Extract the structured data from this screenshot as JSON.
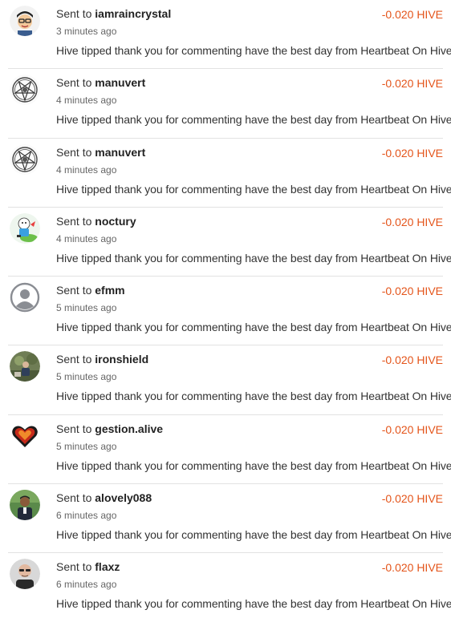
{
  "transfers": [
    {
      "prefix": "Sent to",
      "user": "iamraincrystal",
      "amount": "-0.020 HIVE",
      "time": "3 minutes ago",
      "memo": "Hive tipped thank you for commenting have the best day from Heartbeat On Hive",
      "avatar": "cartoon-face-avatar"
    },
    {
      "prefix": "Sent to",
      "user": "manuvert",
      "amount": "-0.020 HIVE",
      "time": "4 minutes ago",
      "memo": "Hive tipped thank you for commenting have the best day from Heartbeat On Hive",
      "avatar": "pentagram-avatar"
    },
    {
      "prefix": "Sent to",
      "user": "manuvert",
      "amount": "-0.020 HIVE",
      "time": "4 minutes ago",
      "memo": "Hive tipped thank you for commenting have the best day from Heartbeat On Hive",
      "avatar": "pentagram-avatar"
    },
    {
      "prefix": "Sent to",
      "user": "noctury",
      "amount": "-0.020 HIVE",
      "time": "4 minutes ago",
      "memo": "Hive tipped thank you for commenting have the best day from Heartbeat On Hive",
      "avatar": "cartoon-character-avatar"
    },
    {
      "prefix": "Sent to",
      "user": "efmm",
      "amount": "-0.020 HIVE",
      "time": "5 minutes ago",
      "memo": "Hive tipped thank you for commenting have the best day from Heartbeat On Hive",
      "avatar": "default-user-icon"
    },
    {
      "prefix": "Sent to",
      "user": "ironshield",
      "amount": "-0.020 HIVE",
      "time": "5 minutes ago",
      "memo": "Hive tipped thank you for commenting have the best day from Heartbeat On Hive",
      "avatar": "photo-avatar"
    },
    {
      "prefix": "Sent to",
      "user": "gestion.alive",
      "amount": "-0.020 HIVE",
      "time": "5 minutes ago",
      "memo": "Hive tipped thank you for commenting have the best day from Heartbeat On Hive",
      "avatar": "heart-avatar"
    },
    {
      "prefix": "Sent to",
      "user": "alovely088",
      "amount": "-0.020 HIVE",
      "time": "6 minutes ago",
      "memo": "Hive tipped thank you for commenting have the best day from Heartbeat On Hive",
      "avatar": "person-photo-avatar"
    },
    {
      "prefix": "Sent to",
      "user": "flaxz",
      "amount": "-0.020 HIVE",
      "time": "6 minutes ago",
      "memo": "Hive tipped thank you for commenting have the best day from Heartbeat On Hive",
      "avatar": "person-photo-avatar"
    }
  ],
  "colors": {
    "amount": "#e4541a",
    "divider": "#e2e2e2"
  }
}
